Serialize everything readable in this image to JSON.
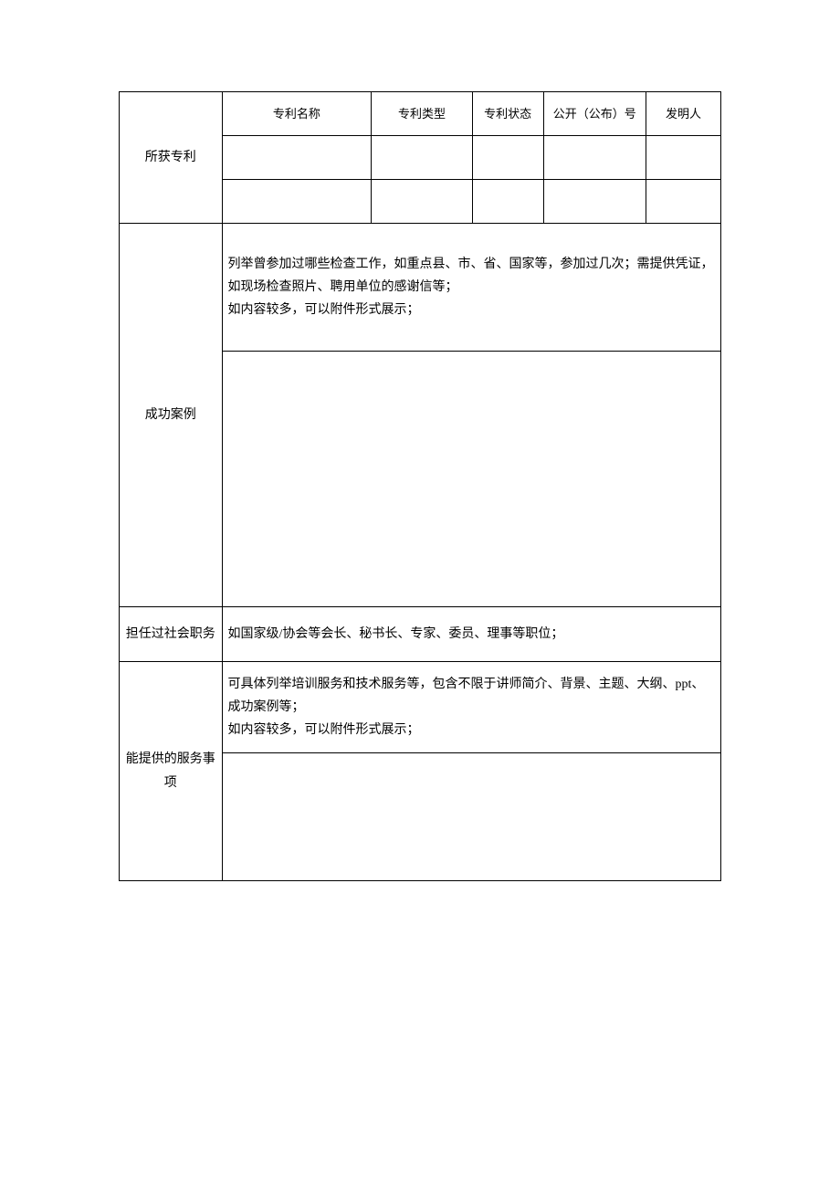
{
  "patents": {
    "row_label": "所获专利",
    "headers": {
      "name": "专利名称",
      "type": "专利类型",
      "status": "专利状态",
      "number": "公开（公布）号",
      "inventor": "发明人"
    },
    "rows": [
      {
        "name": "",
        "type": "",
        "status": "",
        "number": "",
        "inventor": ""
      },
      {
        "name": "",
        "type": "",
        "status": "",
        "number": "",
        "inventor": ""
      }
    ]
  },
  "success_cases": {
    "row_label": "成功案例",
    "instruction": "列举曾参加过哪些检查工作，如重点县、市、省、国家等，参加过几次；需提供凭证，如现场检查照片、聘用单位的感谢信等；\n如内容较多，可以附件形式展示；",
    "content": ""
  },
  "social_positions": {
    "row_label": "担任过社会职务",
    "instruction": "如国家级/协会等会长、秘书长、专家、委员、理事等职位；"
  },
  "services": {
    "row_label": "能提供的服务事项",
    "instruction": "可具体列举培训服务和技术服务等，包含不限于讲师简介、背景、主题、大纲、ppt、成功案例等；\n如内容较多，可以附件形式展示；",
    "content": ""
  }
}
